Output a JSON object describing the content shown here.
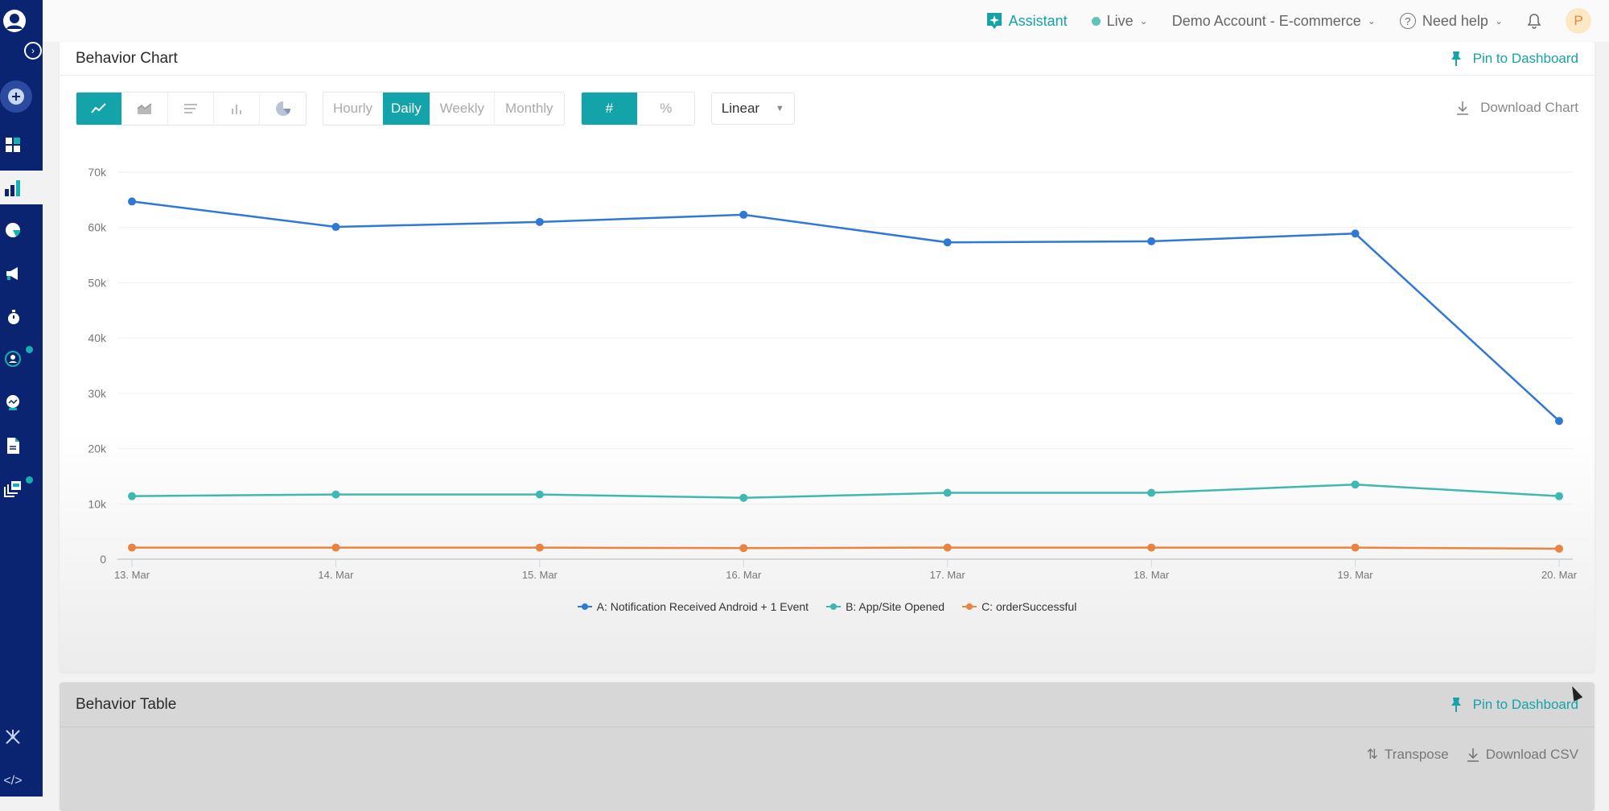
{
  "sidebar": {
    "items": [
      {
        "icon": "user-profile-icon"
      },
      {
        "icon": "expand-sidebar-icon"
      },
      {
        "icon": "create-plus-icon"
      },
      {
        "icon": "dashboard-icon"
      },
      {
        "icon": "analytics-bar-icon",
        "active": true
      },
      {
        "icon": "segments-pie-icon"
      },
      {
        "icon": "campaigns-megaphone-icon"
      },
      {
        "icon": "journeys-stopwatch-icon"
      },
      {
        "icon": "personalization-user-target-icon",
        "badge": true
      },
      {
        "icon": "insights-trend-icon"
      },
      {
        "icon": "reports-document-icon"
      },
      {
        "icon": "content-cards-icon",
        "badge": true
      },
      {
        "icon": "integrations-network-icon"
      },
      {
        "icon": "developer-code-icon"
      }
    ]
  },
  "topbar": {
    "assistant": "Assistant",
    "env": "Live",
    "account": "Demo Account - E-commerce",
    "help": "Need help",
    "avatar_initial": "P"
  },
  "behavior_chart": {
    "title": "Behavior Chart",
    "pin_label": "Pin to Dashboard",
    "chart_types": [
      {
        "icon": "line-chart-icon",
        "active": true
      },
      {
        "icon": "area-chart-icon",
        "active": false
      },
      {
        "icon": "horizontal-bar-icon",
        "active": false
      },
      {
        "icon": "vertical-bar-icon",
        "active": false
      },
      {
        "icon": "pie-chart-icon",
        "active": false
      }
    ],
    "granularity": [
      {
        "label": "Hourly",
        "active": false
      },
      {
        "label": "Daily",
        "active": true
      },
      {
        "label": "Weekly",
        "active": false
      },
      {
        "label": "Monthly",
        "active": false
      }
    ],
    "value_mode": [
      {
        "label": "#",
        "active": true
      },
      {
        "label": "%",
        "active": false
      }
    ],
    "scale_select": "Linear",
    "download_label": "Download Chart"
  },
  "chart_data": {
    "type": "line",
    "title": "",
    "xlabel": "",
    "ylabel": "",
    "x": [
      "13. Mar",
      "14. Mar",
      "15. Mar",
      "16. Mar",
      "17. Mar",
      "18. Mar",
      "19. Mar",
      "20. Mar"
    ],
    "yticks": [
      "0",
      "10k",
      "20k",
      "30k",
      "40k",
      "50k",
      "60k",
      "70k"
    ],
    "ylim": [
      0,
      70000
    ],
    "grid": true,
    "legend_position": "bottom-center",
    "series": [
      {
        "name": "A: Notification Received Android + 1 Event",
        "color": "#2f78d6",
        "values": [
          64700,
          60100,
          61000,
          62300,
          57300,
          57500,
          58900,
          25000
        ]
      },
      {
        "name": "B: App/Site Opened",
        "color": "#3fb8b3",
        "values": [
          11400,
          11700,
          11700,
          11100,
          12000,
          12000,
          13500,
          11400
        ]
      },
      {
        "name": "C: orderSuccessful",
        "color": "#e8843f",
        "values": [
          2100,
          2100,
          2100,
          2000,
          2100,
          2100,
          2100,
          1900
        ]
      }
    ]
  },
  "behavior_table": {
    "title": "Behavior Table",
    "pin_label": "Pin to Dashboard",
    "transpose_label": "Transpose",
    "download_label": "Download CSV"
  }
}
